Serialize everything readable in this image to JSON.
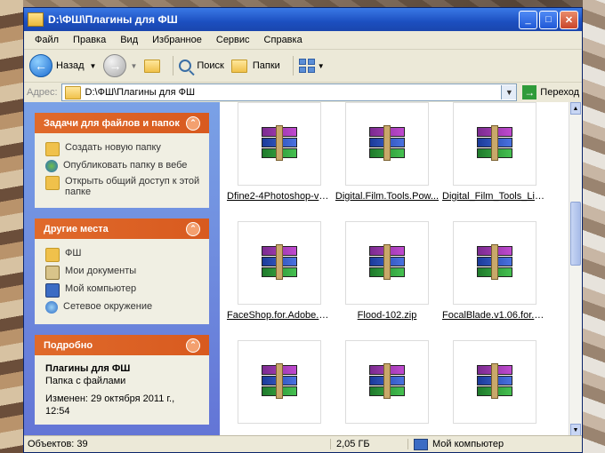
{
  "window": {
    "title": "D:\\ФШ\\Плагины для ФШ"
  },
  "menu": [
    "Файл",
    "Правка",
    "Вид",
    "Избранное",
    "Сервис",
    "Справка"
  ],
  "toolbar": {
    "back": "Назад",
    "search": "Поиск",
    "folders": "Папки"
  },
  "address": {
    "label": "Адрес:",
    "value": "D:\\ФШ\\Плагины для ФШ",
    "go": "Переход"
  },
  "tasks": {
    "title": "Задачи для файлов и папок",
    "items": [
      "Создать новую папку",
      "Опубликовать папку в вебе",
      "Открыть общий доступ к этой папке"
    ]
  },
  "places": {
    "title": "Другие места",
    "items": [
      "ФШ",
      "Мои документы",
      "Мой компьютер",
      "Сетевое окружение"
    ]
  },
  "details": {
    "title": "Подробно",
    "name": "Плагины для ФШ",
    "type": "Папка с файлами",
    "modified": "Изменен: 29 октября 2011 г., 12:54"
  },
  "files": [
    "Dfine2-4Photoshop-ver...",
    "Digital.Film.Tools.Pow...",
    "Digital_Film_Tools_Ligh...",
    "FaceShop.for.Adobe.P...",
    "Flood-102.zip",
    "FocalBlade.v1.06.for.A...",
    "",
    "",
    ""
  ],
  "status": {
    "objects": "Объектов: 39",
    "size": "2,05 ГБ",
    "location": "Мой компьютер"
  },
  "colors": {
    "title_bar": "#1c4fc0",
    "panel_header": "#e06a2b",
    "left_pane": "#6f8be0"
  }
}
